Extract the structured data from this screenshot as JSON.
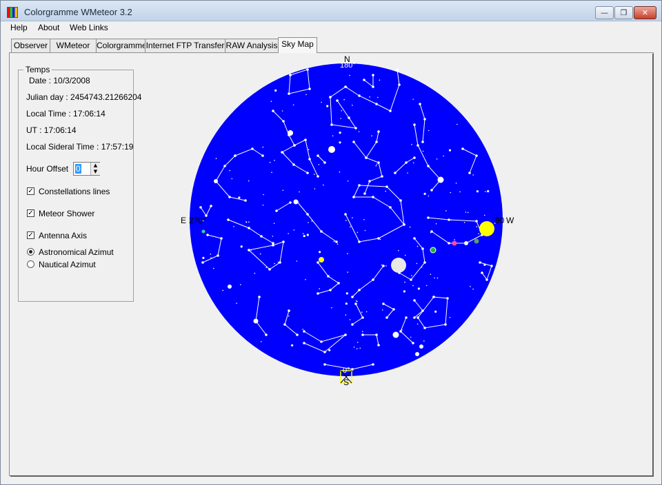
{
  "window": {
    "title": "Colorgramme WMeteor 3.2",
    "buttons": {
      "minimize": "—",
      "maximize": "❐",
      "close": "✕"
    }
  },
  "menu": [
    "Help",
    "About",
    "Web Links"
  ],
  "tabs": [
    {
      "label": "Observer",
      "active": false
    },
    {
      "label": "WMeteor",
      "active": false
    },
    {
      "label": "Colorgramme",
      "active": false
    },
    {
      "label": "Internet FTP Transfer",
      "active": false
    },
    {
      "label": "RAW Analysis",
      "active": false
    },
    {
      "label": "Sky Map",
      "active": true
    }
  ],
  "temps": {
    "legend": "Temps",
    "date": "Date : 10/3/2008",
    "julian_day": "Julian day : 2454743.21266204",
    "local_time": "Local Time : 17:06:14",
    "ut": "UT : 17:06:14",
    "local_sidereal_time": "Local Sideral Time : 17:57:19",
    "hour_offset_label": "Hour Offset",
    "hour_offset_value": "0",
    "spin_up": "▲",
    "spin_down": "▼"
  },
  "options": {
    "constellation_lines": {
      "label": "Constellations lines",
      "checked": true
    },
    "meteor_shower": {
      "label": "Meteor Shower",
      "checked": true
    },
    "antenna_axis": {
      "label": "Antenna Axis",
      "checked": true
    },
    "check_mark": "✓"
  },
  "azimut": {
    "astronomical": {
      "label": "Astronomical Azimut",
      "selected": true
    },
    "nautical": {
      "label": "Nautical Azimut",
      "selected": false
    }
  },
  "sky_map": {
    "north": "N",
    "north_deg": "180°",
    "south": "S",
    "south_deg": "0°",
    "east": "E",
    "east_deg": "270°",
    "west": "W",
    "west_deg": "90",
    "colors": {
      "sky": "#0000ff",
      "stars": "#ffffff",
      "sun": "#ffff00",
      "moon": "#e8e8e8",
      "antenna": "#ffff00"
    }
  }
}
